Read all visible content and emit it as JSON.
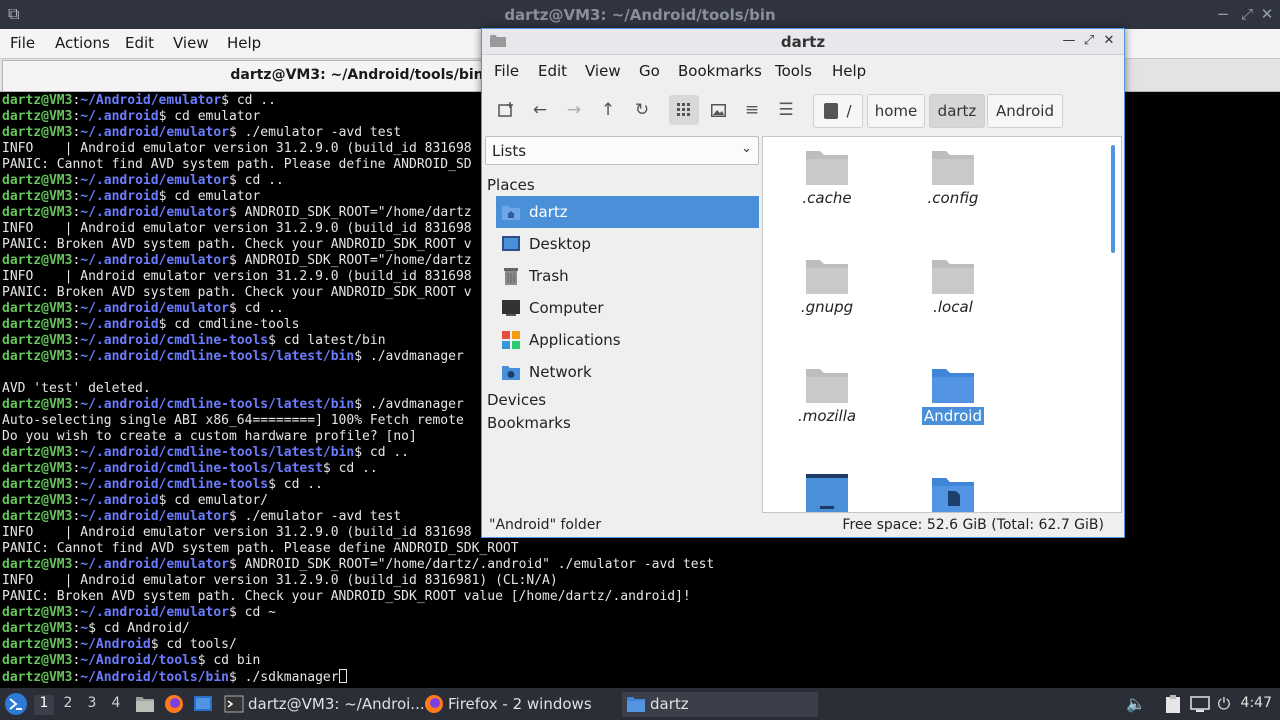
{
  "terminal": {
    "window_title": "dartz@VM3: ~/Android/tools/bin",
    "menu": [
      "File",
      "Actions",
      "Edit",
      "View",
      "Help"
    ],
    "tab_title": "dartz@VM3: ~/Android/tools/bin",
    "lines": [
      {
        "prompt": true,
        "user": "dartz@VM3",
        "path": "~/Android/emulator",
        "cmd": " cd .."
      },
      {
        "prompt": true,
        "user": "dartz@VM3",
        "path": "~/.android",
        "cmd": " cd emulator"
      },
      {
        "prompt": true,
        "user": "dartz@VM3",
        "path": "~/.android/emulator",
        "cmd": " ./emulator -avd test"
      },
      {
        "prompt": false,
        "text": "INFO    | Android emulator version 31.2.9.0 (build_id 831698"
      },
      {
        "prompt": false,
        "text": "PANIC: Cannot find AVD system path. Please define ANDROID_SD"
      },
      {
        "prompt": true,
        "user": "dartz@VM3",
        "path": "~/.android/emulator",
        "cmd": " cd .."
      },
      {
        "prompt": true,
        "user": "dartz@VM3",
        "path": "~/.android",
        "cmd": " cd emulator"
      },
      {
        "prompt": true,
        "user": "dartz@VM3",
        "path": "~/.android/emulator",
        "cmd": " ANDROID_SDK_ROOT=\"/home/dartz"
      },
      {
        "prompt": false,
        "text": "INFO    | Android emulator version 31.2.9.0 (build_id 831698"
      },
      {
        "prompt": false,
        "text": "PANIC: Broken AVD system path. Check your ANDROID_SDK_ROOT v"
      },
      {
        "prompt": true,
        "user": "dartz@VM3",
        "path": "~/.android/emulator",
        "cmd": " ANDROID_SDK_ROOT=\"/home/dartz"
      },
      {
        "prompt": false,
        "text": "INFO    | Android emulator version 31.2.9.0 (build_id 831698"
      },
      {
        "prompt": false,
        "text": "PANIC: Broken AVD system path. Check your ANDROID_SDK_ROOT v"
      },
      {
        "prompt": true,
        "user": "dartz@VM3",
        "path": "~/.android/emulator",
        "cmd": " cd .."
      },
      {
        "prompt": true,
        "user": "dartz@VM3",
        "path": "~/.android",
        "cmd": " cd cmdline-tools"
      },
      {
        "prompt": true,
        "user": "dartz@VM3",
        "path": "~/.android/cmdline-tools",
        "cmd": " cd latest/bin"
      },
      {
        "prompt": true,
        "user": "dartz@VM3",
        "path": "~/.android/cmdline-tools/latest/bin",
        "cmd": " ./avdmanager"
      },
      {
        "prompt": false,
        "text": ""
      },
      {
        "prompt": false,
        "text": "AVD 'test' deleted."
      },
      {
        "prompt": true,
        "user": "dartz@VM3",
        "path": "~/.android/cmdline-tools/latest/bin",
        "cmd": " ./avdmanager"
      },
      {
        "prompt": false,
        "text": "Auto-selecting single ABI x86_64========] 100% Fetch remote"
      },
      {
        "prompt": false,
        "text": "Do you wish to create a custom hardware profile? [no]"
      },
      {
        "prompt": true,
        "user": "dartz@VM3",
        "path": "~/.android/cmdline-tools/latest/bin",
        "cmd": " cd .."
      },
      {
        "prompt": true,
        "user": "dartz@VM3",
        "path": "~/.android/cmdline-tools/latest",
        "cmd": " cd .."
      },
      {
        "prompt": true,
        "user": "dartz@VM3",
        "path": "~/.android/cmdline-tools",
        "cmd": " cd .."
      },
      {
        "prompt": true,
        "user": "dartz@VM3",
        "path": "~/.android",
        "cmd": " cd emulator/"
      },
      {
        "prompt": true,
        "user": "dartz@VM3",
        "path": "~/.android/emulator",
        "cmd": " ./emulator -avd test"
      },
      {
        "prompt": false,
        "text": "INFO    | Android emulator version 31.2.9.0 (build_id 831698"
      },
      {
        "prompt": false,
        "text": "PANIC: Cannot find AVD system path. Please define ANDROID_SDK_ROOT"
      },
      {
        "prompt": true,
        "user": "dartz@VM3",
        "path": "~/.android/emulator",
        "cmd": " ANDROID_SDK_ROOT=\"/home/dartz/.android\" ./emulator -avd test"
      },
      {
        "prompt": false,
        "text": "INFO    | Android emulator version 31.2.9.0 (build_id 8316981) (CL:N/A)"
      },
      {
        "prompt": false,
        "text": "PANIC: Broken AVD system path. Check your ANDROID_SDK_ROOT value [/home/dartz/.android]!"
      },
      {
        "prompt": true,
        "user": "dartz@VM3",
        "path": "~/.android/emulator",
        "cmd": " cd ~"
      },
      {
        "prompt": true,
        "user": "dartz@VM3",
        "path": "~",
        "cmd": " cd Android/"
      },
      {
        "prompt": true,
        "user": "dartz@VM3",
        "path": "~/Android",
        "cmd": " cd tools/"
      },
      {
        "prompt": true,
        "user": "dartz@VM3",
        "path": "~/Android/tools",
        "cmd": " cd bin"
      },
      {
        "prompt": true,
        "user": "dartz@VM3",
        "path": "~/Android/tools/bin",
        "cmd": " ./sdkmanager",
        "cursor": true
      }
    ]
  },
  "file_manager": {
    "window_title": "dartz",
    "menu": [
      "File",
      "Edit",
      "View",
      "Go",
      "Bookmarks",
      "Tools",
      "Help"
    ],
    "path_buttons": [
      "/",
      "home",
      "dartz",
      "Android"
    ],
    "side_select": "Lists",
    "places_header": "Places",
    "places": [
      {
        "label": "dartz",
        "icon": "home-folder-icon",
        "selected": true
      },
      {
        "label": "Desktop",
        "icon": "desktop-icon",
        "selected": false
      },
      {
        "label": "Trash",
        "icon": "trash-icon",
        "selected": false
      },
      {
        "label": "Computer",
        "icon": "computer-icon",
        "selected": false
      },
      {
        "label": "Applications",
        "icon": "applications-icon",
        "selected": false
      },
      {
        "label": "Network",
        "icon": "network-icon",
        "selected": false
      }
    ],
    "devices_header": "Devices",
    "bookmarks_header": "Bookmarks",
    "items": [
      {
        "name": ".cache",
        "type": "hidden"
      },
      {
        "name": ".config",
        "type": "hidden"
      },
      {
        "name": ".gnupg",
        "type": "hidden"
      },
      {
        "name": ".local",
        "type": "hidden"
      },
      {
        "name": ".mozilla",
        "type": "hidden"
      },
      {
        "name": "Android",
        "type": "selected"
      },
      {
        "name": "",
        "type": "desktop"
      },
      {
        "name": "",
        "type": "documents"
      }
    ],
    "status_left": "\"Android\" folder",
    "status_right": "Free space: 52.6 GiB (Total: 62.7 GiB)"
  },
  "taskbar": {
    "workspaces": [
      "1",
      "2",
      "3",
      "4"
    ],
    "tasks": [
      {
        "label": "dartz@VM3: ~/Androi...",
        "icon": "terminal-icon"
      },
      {
        "label": "Firefox - 2 windows",
        "icon": "firefox-icon"
      },
      {
        "label": "dartz",
        "icon": "folder-icon"
      }
    ],
    "clock": "4:47"
  },
  "colors": {
    "prompt_user": "#67c25c",
    "prompt_path": "#6b7cff",
    "selection": "#4a90d9",
    "accent": "#5294e2"
  }
}
